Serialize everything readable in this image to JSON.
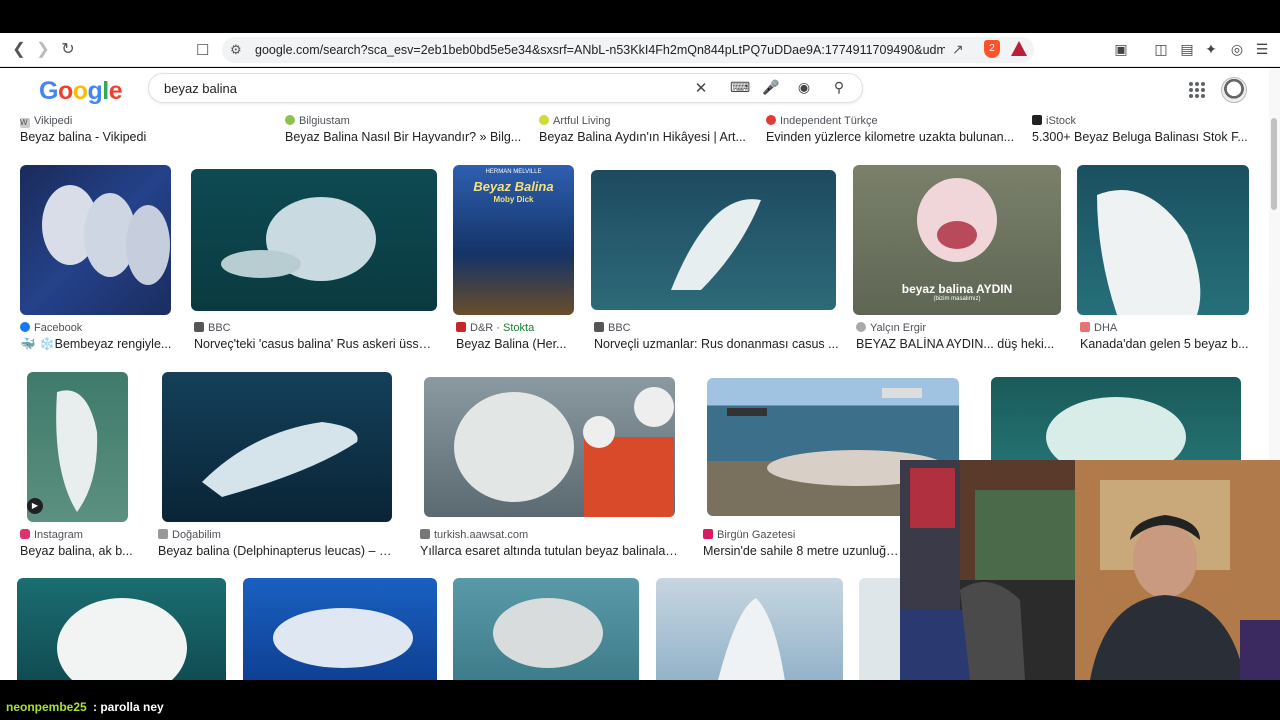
{
  "browser": {
    "url": "google.com/search?sca_esv=2eb1beb0bd5e5e34&sxsrf=ANbL-n53KkI4Fh2mQn844pLtPQ7uDDae9A:1774911709490&udm=2&fbs...",
    "brave_badge": "2"
  },
  "search": {
    "logo": "Google",
    "query": "beyaz balina"
  },
  "top_results": [
    {
      "source": "Vikipedi",
      "title": "Beyaz balina - Vikipedi"
    },
    {
      "source": "Bilgiustam",
      "title": "Beyaz Balina Nasıl Bir Hayvandır? » Bilg..."
    },
    {
      "source": "Artful Living",
      "title": "Beyaz Balina Aydın'ın Hikâyesi | Art..."
    },
    {
      "source": "Independent Türkçe",
      "title": "Evinden yüzlerce kilometre uzakta bulunan..."
    },
    {
      "source": "iStock",
      "title": "5.300+ Beyaz Beluga Balinası Stok F..."
    }
  ],
  "row1": [
    {
      "source": "Facebook",
      "title": "🐳 ❄️Bembeyaz rengiyle..."
    },
    {
      "source": "BBC",
      "title": "Norveç'teki 'casus balina' Rus askeri üssü..."
    },
    {
      "source": "D&R",
      "stock": "Stokta",
      "title": "Beyaz Balina (Her...",
      "book_title": "Beyaz Balina",
      "book_sub": "Moby Dick",
      "book_author": "HERMAN MELVILLE"
    },
    {
      "source": "BBC",
      "title": "Norveçli uzmanlar: Rus donanması casus ..."
    },
    {
      "source": "Yalçın Ergir",
      "title": "BEYAZ BALİNA AYDIN... düş heki...",
      "caption": "beyaz balina AYDIN",
      "caption_sub": "(bizim masalımız)"
    },
    {
      "source": "DHA",
      "title": "Kanada'dan gelen 5 beyaz b..."
    }
  ],
  "row2": [
    {
      "source": "Instagram",
      "title": "Beyaz balina, ak b..."
    },
    {
      "source": "Doğabilim",
      "title": "Beyaz balina (Delphinapterus leucas) – D..."
    },
    {
      "source": "turkish.aawsat.com",
      "title": "Yıllarca esaret altında tutulan beyaz balinaları..."
    },
    {
      "source": "Birgün Gazetesi",
      "title": "Mersin'de sahile 8 metre uzunluğund"
    }
  ],
  "chat": {
    "user": "neonpembe25",
    "message": ": parolla ney"
  }
}
